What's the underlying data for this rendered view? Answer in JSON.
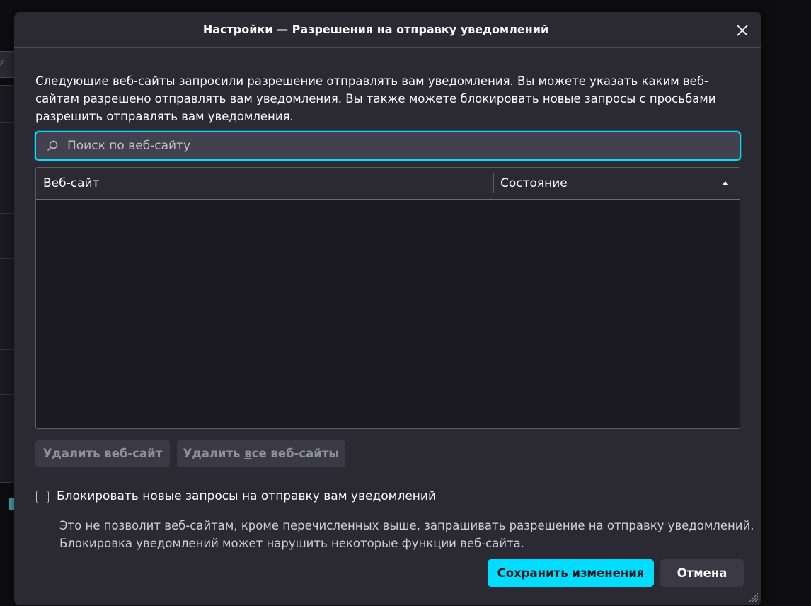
{
  "dialog": {
    "title": "Настройки — Разрешения на отправку уведомлений",
    "close_icon": "close-icon",
    "description": "Следующие веб-сайты запросили разрешение отправлять вам уведомления. Вы можете указать каким веб-сайтам разрешено отправлять вам уведомления. Вы также можете блокировать новые запросы с просьбами разрешить отправлять вам уведомления."
  },
  "search": {
    "placeholder": "Поиск по веб-сайту",
    "value": "",
    "icon": "search-icon"
  },
  "table": {
    "columns": [
      {
        "label": "Веб-сайт"
      },
      {
        "label": "Состояние",
        "sort": "ascending"
      }
    ],
    "rows": []
  },
  "buttons": {
    "remove_site_label": "Удалить веб-сайт",
    "remove_all_prefix": "Удалить ",
    "remove_all_underlined": "в",
    "remove_all_suffix": "се веб-сайты",
    "save_prefix": "Со",
    "save_underlined": "х",
    "save_suffix": "ранить изменения",
    "cancel_label": "Отмена"
  },
  "block_option": {
    "checked": false,
    "label": "Блокировать новые запросы на отправку вам уведомлений",
    "help_line1": "Это не позволит веб-сайтам, кроме перечисленных выше, запрашивать разрешение на отправку уведомлений.",
    "help_line2": "Блокировка уведомлений может нарушить некоторые функции веб-сайта."
  },
  "colors": {
    "accent": "#00ddff",
    "dialog_bg": "#2b2a33",
    "list_bg": "#1c1b22",
    "text": "#fbfbfe"
  }
}
